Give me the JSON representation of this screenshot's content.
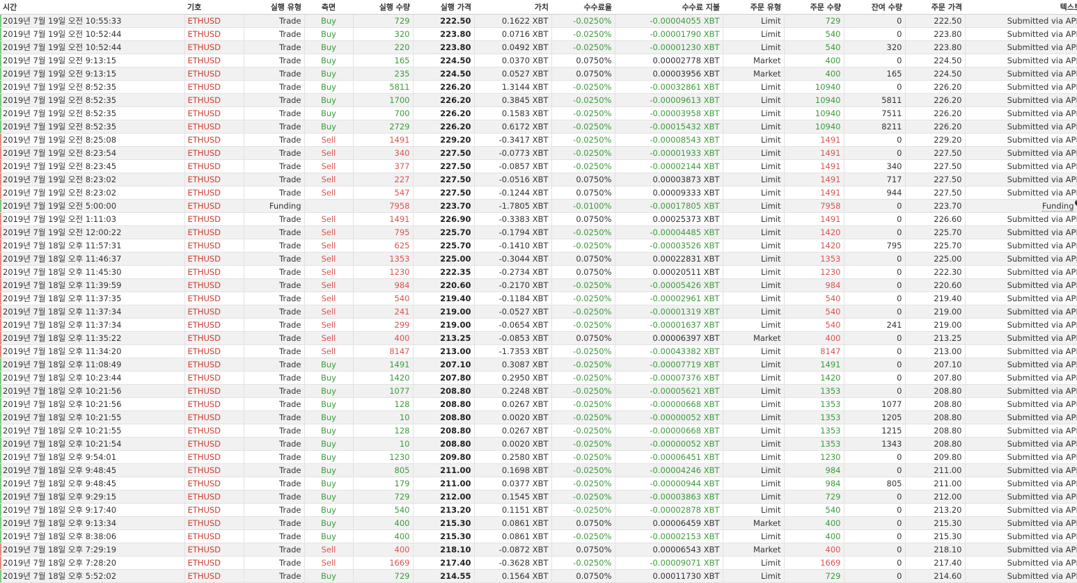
{
  "columns": [
    "시간",
    "기호",
    "실행 유형",
    "측면",
    "실행 수량",
    "실행 가격",
    "가치",
    "수수료율",
    "수수료 지불",
    "주문 유형",
    "주문 수량",
    "잔여 수량",
    "주문 가격",
    "텍스트"
  ],
  "colors": {
    "buy": "#3b9b3b",
    "sell": "#d9534f",
    "symbol": "#d03a2f"
  },
  "rows": [
    [
      "2019년 7월 19일 오전 10:55:33",
      "ETHUSD",
      "Trade",
      "Buy",
      "729",
      "222.50",
      "0.1622 XBT",
      "-0.0250%",
      "-0.00004055 XBT",
      "Limit",
      "729",
      "0",
      "222.50",
      "Submitted via API."
    ],
    [
      "2019년 7월 19일 오전 10:52:44",
      "ETHUSD",
      "Trade",
      "Buy",
      "320",
      "223.80",
      "0.0716 XBT",
      "-0.0250%",
      "-0.00001790 XBT",
      "Limit",
      "540",
      "0",
      "223.80",
      "Submitted via API."
    ],
    [
      "2019년 7월 19일 오전 10:52:44",
      "ETHUSD",
      "Trade",
      "Buy",
      "220",
      "223.80",
      "0.0492 XBT",
      "-0.0250%",
      "-0.00001230 XBT",
      "Limit",
      "540",
      "320",
      "223.80",
      "Submitted via API."
    ],
    [
      "2019년 7월 19일 오전 9:13:15",
      "ETHUSD",
      "Trade",
      "Buy",
      "165",
      "224.50",
      "0.0370 XBT",
      "0.0750%",
      "0.00002778 XBT",
      "Market",
      "400",
      "0",
      "224.50",
      "Submitted via API."
    ],
    [
      "2019년 7월 19일 오전 9:13:15",
      "ETHUSD",
      "Trade",
      "Buy",
      "235",
      "224.50",
      "0.0527 XBT",
      "0.0750%",
      "0.00003956 XBT",
      "Market",
      "400",
      "165",
      "224.50",
      "Submitted via API."
    ],
    [
      "2019년 7월 19일 오전 8:52:35",
      "ETHUSD",
      "Trade",
      "Buy",
      "5811",
      "226.20",
      "1.3144 XBT",
      "-0.0250%",
      "-0.00032861 XBT",
      "Limit",
      "10940",
      "0",
      "226.20",
      "Submitted via API."
    ],
    [
      "2019년 7월 19일 오전 8:52:35",
      "ETHUSD",
      "Trade",
      "Buy",
      "1700",
      "226.20",
      "0.3845 XBT",
      "-0.0250%",
      "-0.00009613 XBT",
      "Limit",
      "10940",
      "5811",
      "226.20",
      "Submitted via API."
    ],
    [
      "2019년 7월 19일 오전 8:52:35",
      "ETHUSD",
      "Trade",
      "Buy",
      "700",
      "226.20",
      "0.1583 XBT",
      "-0.0250%",
      "-0.00003958 XBT",
      "Limit",
      "10940",
      "7511",
      "226.20",
      "Submitted via API."
    ],
    [
      "2019년 7월 19일 오전 8:52:35",
      "ETHUSD",
      "Trade",
      "Buy",
      "2729",
      "226.20",
      "0.6172 XBT",
      "-0.0250%",
      "-0.00015432 XBT",
      "Limit",
      "10940",
      "8211",
      "226.20",
      "Submitted via API."
    ],
    [
      "2019년 7월 19일 오전 8:25:08",
      "ETHUSD",
      "Trade",
      "Sell",
      "1491",
      "229.20",
      "-0.3417 XBT",
      "-0.0250%",
      "-0.00008543 XBT",
      "Limit",
      "1491",
      "0",
      "229.20",
      "Submitted via API."
    ],
    [
      "2019년 7월 19일 오전 8:23:54",
      "ETHUSD",
      "Trade",
      "Sell",
      "340",
      "227.50",
      "-0.0773 XBT",
      "-0.0250%",
      "-0.00001933 XBT",
      "Limit",
      "1491",
      "0",
      "227.50",
      "Submitted via API."
    ],
    [
      "2019년 7월 19일 오전 8:23:45",
      "ETHUSD",
      "Trade",
      "Sell",
      "377",
      "227.50",
      "-0.0857 XBT",
      "-0.0250%",
      "-0.00002144 XBT",
      "Limit",
      "1491",
      "340",
      "227.50",
      "Submitted via API."
    ],
    [
      "2019년 7월 19일 오전 8:23:02",
      "ETHUSD",
      "Trade",
      "Sell",
      "227",
      "227.50",
      "-0.0516 XBT",
      "0.0750%",
      "0.00003873 XBT",
      "Limit",
      "1491",
      "717",
      "227.50",
      "Submitted via API."
    ],
    [
      "2019년 7월 19일 오전 8:23:02",
      "ETHUSD",
      "Trade",
      "Sell",
      "547",
      "227.50",
      "-0.1244 XBT",
      "0.0750%",
      "0.00009333 XBT",
      "Limit",
      "1491",
      "944",
      "227.50",
      "Submitted via API."
    ],
    [
      "2019년 7월 19일 오전 5:00:00",
      "ETHUSD",
      "Funding",
      "",
      "7958",
      "223.70",
      "-1.7805 XBT",
      "-0.0100%",
      "-0.00017805 XBT",
      "Limit",
      "7958",
      "0",
      "223.70",
      "Funding"
    ],
    [
      "2019년 7월 19일 오전 1:11:03",
      "ETHUSD",
      "Trade",
      "Sell",
      "1491",
      "226.90",
      "-0.3383 XBT",
      "0.0750%",
      "0.00025373 XBT",
      "Limit",
      "1491",
      "0",
      "226.60",
      "Submitted via API."
    ],
    [
      "2019년 7월 19일 오전 12:00:22",
      "ETHUSD",
      "Trade",
      "Sell",
      "795",
      "225.70",
      "-0.1794 XBT",
      "-0.0250%",
      "-0.00004485 XBT",
      "Limit",
      "1420",
      "0",
      "225.70",
      "Submitted via API."
    ],
    [
      "2019년 7월 18일 오후 11:57:31",
      "ETHUSD",
      "Trade",
      "Sell",
      "625",
      "225.70",
      "-0.1410 XBT",
      "-0.0250%",
      "-0.00003526 XBT",
      "Limit",
      "1420",
      "795",
      "225.70",
      "Submitted via API."
    ],
    [
      "2019년 7월 18일 오후 11:46:37",
      "ETHUSD",
      "Trade",
      "Sell",
      "1353",
      "225.00",
      "-0.3044 XBT",
      "0.0750%",
      "0.00022831 XBT",
      "Limit",
      "1353",
      "0",
      "225.00",
      "Submitted via API."
    ],
    [
      "2019년 7월 18일 오후 11:45:30",
      "ETHUSD",
      "Trade",
      "Sell",
      "1230",
      "222.35",
      "-0.2734 XBT",
      "0.0750%",
      "0.00020511 XBT",
      "Limit",
      "1230",
      "0",
      "222.30",
      "Submitted via API."
    ],
    [
      "2019년 7월 18일 오후 11:39:59",
      "ETHUSD",
      "Trade",
      "Sell",
      "984",
      "220.60",
      "-0.2170 XBT",
      "-0.0250%",
      "-0.00005426 XBT",
      "Limit",
      "984",
      "0",
      "220.60",
      "Submitted via API."
    ],
    [
      "2019년 7월 18일 오후 11:37:35",
      "ETHUSD",
      "Trade",
      "Sell",
      "540",
      "219.40",
      "-0.1184 XBT",
      "-0.0250%",
      "-0.00002961 XBT",
      "Limit",
      "540",
      "0",
      "219.40",
      "Submitted via API."
    ],
    [
      "2019년 7월 18일 오후 11:37:34",
      "ETHUSD",
      "Trade",
      "Sell",
      "241",
      "219.00",
      "-0.0527 XBT",
      "-0.0250%",
      "-0.00001319 XBT",
      "Limit",
      "540",
      "0",
      "219.00",
      "Submitted via API."
    ],
    [
      "2019년 7월 18일 오후 11:37:34",
      "ETHUSD",
      "Trade",
      "Sell",
      "299",
      "219.00",
      "-0.0654 XBT",
      "-0.0250%",
      "-0.00001637 XBT",
      "Limit",
      "540",
      "241",
      "219.00",
      "Submitted via API."
    ],
    [
      "2019년 7월 18일 오후 11:35:22",
      "ETHUSD",
      "Trade",
      "Sell",
      "400",
      "213.25",
      "-0.0853 XBT",
      "0.0750%",
      "0.00006397 XBT",
      "Market",
      "400",
      "0",
      "213.25",
      "Submitted via API."
    ],
    [
      "2019년 7월 18일 오후 11:34:20",
      "ETHUSD",
      "Trade",
      "Sell",
      "8147",
      "213.00",
      "-1.7353 XBT",
      "-0.0250%",
      "-0.00043382 XBT",
      "Limit",
      "8147",
      "0",
      "213.00",
      "Submitted via API."
    ],
    [
      "2019년 7월 18일 오후 11:08:49",
      "ETHUSD",
      "Trade",
      "Buy",
      "1491",
      "207.10",
      "0.3087 XBT",
      "-0.0250%",
      "-0.00007719 XBT",
      "Limit",
      "1491",
      "0",
      "207.10",
      "Submitted via API."
    ],
    [
      "2019년 7월 18일 오후 10:23:44",
      "ETHUSD",
      "Trade",
      "Buy",
      "1420",
      "207.80",
      "0.2950 XBT",
      "-0.0250%",
      "-0.00007376 XBT",
      "Limit",
      "1420",
      "0",
      "207.80",
      "Submitted via API."
    ],
    [
      "2019년 7월 18일 오후 10:21:56",
      "ETHUSD",
      "Trade",
      "Buy",
      "1077",
      "208.80",
      "0.2248 XBT",
      "-0.0250%",
      "-0.00005621 XBT",
      "Limit",
      "1353",
      "0",
      "208.80",
      "Submitted via API."
    ],
    [
      "2019년 7월 18일 오후 10:21:56",
      "ETHUSD",
      "Trade",
      "Buy",
      "128",
      "208.80",
      "0.0267 XBT",
      "-0.0250%",
      "-0.00000668 XBT",
      "Limit",
      "1353",
      "1077",
      "208.80",
      "Submitted via API."
    ],
    [
      "2019년 7월 18일 오후 10:21:55",
      "ETHUSD",
      "Trade",
      "Buy",
      "10",
      "208.80",
      "0.0020 XBT",
      "-0.0250%",
      "-0.00000052 XBT",
      "Limit",
      "1353",
      "1205",
      "208.80",
      "Submitted via API."
    ],
    [
      "2019년 7월 18일 오후 10:21:55",
      "ETHUSD",
      "Trade",
      "Buy",
      "128",
      "208.80",
      "0.0267 XBT",
      "-0.0250%",
      "-0.00000668 XBT",
      "Limit",
      "1353",
      "1215",
      "208.80",
      "Submitted via API."
    ],
    [
      "2019년 7월 18일 오후 10:21:54",
      "ETHUSD",
      "Trade",
      "Buy",
      "10",
      "208.80",
      "0.0020 XBT",
      "-0.0250%",
      "-0.00000052 XBT",
      "Limit",
      "1353",
      "1343",
      "208.80",
      "Submitted via API."
    ],
    [
      "2019년 7월 18일 오후 9:54:01",
      "ETHUSD",
      "Trade",
      "Buy",
      "1230",
      "209.80",
      "0.2580 XBT",
      "-0.0250%",
      "-0.00006451 XBT",
      "Limit",
      "1230",
      "0",
      "209.80",
      "Submitted via API."
    ],
    [
      "2019년 7월 18일 오후 9:48:45",
      "ETHUSD",
      "Trade",
      "Buy",
      "805",
      "211.00",
      "0.1698 XBT",
      "-0.0250%",
      "-0.00004246 XBT",
      "Limit",
      "984",
      "0",
      "211.00",
      "Submitted via API."
    ],
    [
      "2019년 7월 18일 오후 9:48:45",
      "ETHUSD",
      "Trade",
      "Buy",
      "179",
      "211.00",
      "0.0377 XBT",
      "-0.0250%",
      "-0.00000944 XBT",
      "Limit",
      "984",
      "805",
      "211.00",
      "Submitted via API."
    ],
    [
      "2019년 7월 18일 오후 9:29:15",
      "ETHUSD",
      "Trade",
      "Buy",
      "729",
      "212.00",
      "0.1545 XBT",
      "-0.0250%",
      "-0.00003863 XBT",
      "Limit",
      "729",
      "0",
      "212.00",
      "Submitted via API."
    ],
    [
      "2019년 7월 18일 오후 9:17:40",
      "ETHUSD",
      "Trade",
      "Buy",
      "540",
      "213.20",
      "0.1151 XBT",
      "-0.0250%",
      "-0.00002878 XBT",
      "Limit",
      "540",
      "0",
      "213.20",
      "Submitted via API."
    ],
    [
      "2019년 7월 18일 오후 9:13:34",
      "ETHUSD",
      "Trade",
      "Buy",
      "400",
      "215.30",
      "0.0861 XBT",
      "0.0750%",
      "0.00006459 XBT",
      "Market",
      "400",
      "0",
      "215.30",
      "Submitted via API."
    ],
    [
      "2019년 7월 18일 오후 8:38:06",
      "ETHUSD",
      "Trade",
      "Buy",
      "400",
      "215.30",
      "0.0861 XBT",
      "-0.0250%",
      "-0.00002153 XBT",
      "Limit",
      "400",
      "0",
      "215.30",
      "Submitted via API."
    ],
    [
      "2019년 7월 18일 오후 7:29:19",
      "ETHUSD",
      "Trade",
      "Sell",
      "400",
      "218.10",
      "-0.0872 XBT",
      "0.0750%",
      "0.00006543 XBT",
      "Market",
      "400",
      "0",
      "218.10",
      "Submitted via API."
    ],
    [
      "2019년 7월 18일 오후 7:28:20",
      "ETHUSD",
      "Trade",
      "Sell",
      "1669",
      "217.40",
      "-0.3628 XBT",
      "-0.0250%",
      "-0.00009071 XBT",
      "Limit",
      "1669",
      "0",
      "217.40",
      "Submitted via API."
    ],
    [
      "2019년 7월 18일 오후 5:52:02",
      "ETHUSD",
      "Trade",
      "Buy",
      "729",
      "214.55",
      "0.1564 XBT",
      "0.0750%",
      "0.00011730 XBT",
      "Limit",
      "729",
      "0",
      "214.60",
      "Submitted via API."
    ]
  ]
}
